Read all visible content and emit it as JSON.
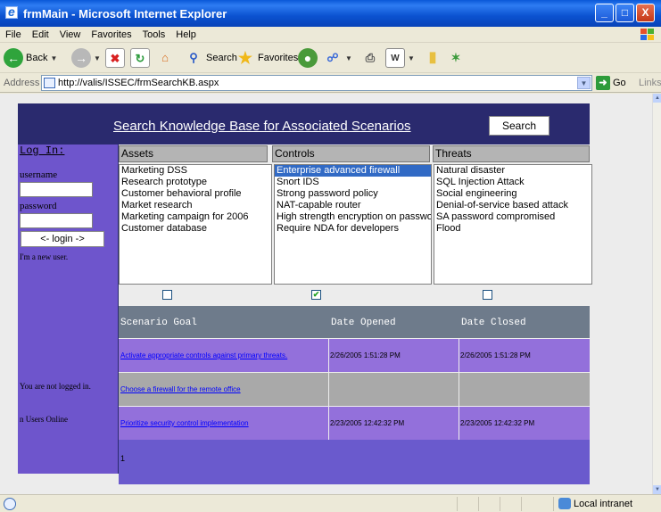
{
  "window": {
    "title": "frmMain - Microsoft Internet Explorer",
    "minimize": "_",
    "maximize": "□",
    "close": "X"
  },
  "menu": [
    "File",
    "Edit",
    "View",
    "Favorites",
    "Tools",
    "Help"
  ],
  "toolbar": {
    "back": "Back",
    "search": "Search",
    "favorites": "Favorites"
  },
  "address": {
    "label": "Address",
    "url": "http://valis/ISSEC/frmSearchKB.aspx",
    "go": "Go",
    "links": "Links"
  },
  "page": {
    "title": "Search Knowledge Base for Associated Scenarios",
    "search_button": "Search"
  },
  "sidebar": {
    "login_title": "Log In:",
    "username_label": "username",
    "password_label": "password",
    "login_button": "<- login ->",
    "new_user": "I'm a new user.",
    "not_logged": "You are not logged in.",
    "users_online": "n Users Online"
  },
  "assets": {
    "header": "Assets",
    "items": [
      "Marketing DSS",
      "Research prototype",
      "Customer behavioral profile",
      "Market research",
      "Marketing campaign for 2006",
      "Customer database"
    ],
    "checked": false
  },
  "controls": {
    "header": "Controls",
    "items": [
      "Enterprise advanced firewall",
      "Snort IDS",
      "Strong password policy",
      "NAT-capable router",
      "High strength encryption on passwo",
      "Require NDA for developers"
    ],
    "selected_index": 0,
    "checked": true
  },
  "threats": {
    "header": "Threats",
    "items": [
      "Natural disaster",
      "SQL Injection Attack",
      "Social engineering",
      "Denial-of-service based attack",
      "SA password compromised",
      "Flood"
    ],
    "checked": false
  },
  "grid": {
    "headers": {
      "goal": "Scenario Goal",
      "opened": "Date Opened",
      "closed": "Date Closed"
    },
    "rows": [
      {
        "goal": "Activate appropriate controls against primary threats.",
        "opened": "2/26/2005 1:51:28 PM",
        "closed": "2/26/2005 1:51:28 PM"
      },
      {
        "goal": "Choose a firewall for the remote office",
        "opened": "",
        "closed": ""
      },
      {
        "goal": "Prioritize security control implementation",
        "opened": "2/23/2005 12:42:32 PM",
        "closed": "2/23/2005 12:42:32 PM"
      }
    ],
    "pager": "1"
  },
  "status": {
    "zone": "Local intranet"
  }
}
